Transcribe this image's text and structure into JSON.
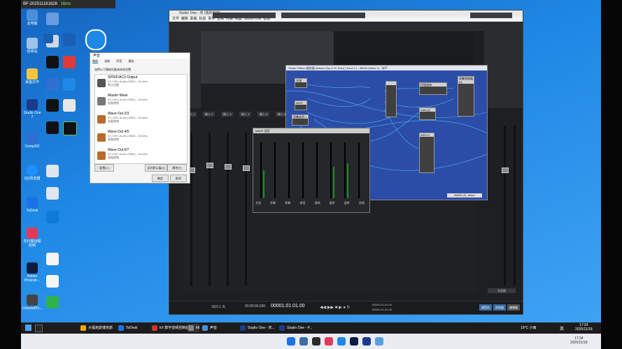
{
  "top_bar": {
    "id": "BF-202511181628",
    "latency": "16ms"
  },
  "desktop_icons": [
    {
      "label": "此电脑",
      "color": "#4a90d9"
    },
    {
      "label": "回收站",
      "color": "#a0c4e8"
    },
    {
      "label": "桌面文件",
      "color": "#f5c542"
    },
    {
      "label": "Studio One 7",
      "color": "#1b3b8a"
    },
    {
      "label": "Compil32",
      "color": "#2f6fd1"
    },
    {
      "label": "QQ浏览器",
      "color": "#1e90ff"
    },
    {
      "label": "ToDesk",
      "color": "#1a73e8"
    },
    {
      "label": "向日葵远程控制",
      "color": "#e03a5a"
    },
    {
      "label": "Adobe Photosh...",
      "color": "#0b1c3f"
    },
    {
      "label": "UninstallTo...",
      "color": "#444"
    }
  ],
  "studio_one": {
    "title": "Studio One - 宋 (我的歌曲)",
    "menu": [
      "文件",
      "编辑",
      "歌曲",
      "轨道",
      "事件",
      "音频",
      "传输",
      "视图",
      "Studio One",
      "帮助"
    ],
    "channel_labels": [
      "输入 1",
      "输入 2",
      "输入 3",
      "输入 4",
      "输入 5",
      "输入 6",
      "输入 7",
      "输入 8"
    ],
    "transport": {
      "time": "00001.01.01.00",
      "position": "16/3.1 大",
      "tempo": "00:00:00.000",
      "loop_start": "00001.01.01.00",
      "loop_end": "00001.01.01.00"
    },
    "right_buttons": [
      "调音台",
      "浏览器",
      "编辑器"
    ],
    "main_label": "主总线"
  },
  "routing_window": {
    "title": "Studio Edition 路由器 (Waves Sys 5 Ch Solo) [ Send 2 ] - 88005 (Wave 2) - 电平",
    "nodes": [
      {
        "label": "主线"
      },
      {
        "label": "ASIO"
      },
      {
        "label": "采集选项-1"
      },
      {
        "label": "环境混响"
      },
      {
        "label": "采集效果器 [1]"
      },
      {
        "label": "Gain [1]"
      },
      {
        "label": "ASIO-1"
      }
    ],
    "status": "88005 (5), Wave"
  },
  "mixer_window": {
    "title": "WAVE 混音",
    "channels": [
      "主动",
      "伴奏",
      "伴奏",
      "说话",
      "混响",
      "监听",
      "监听",
      "总线"
    ]
  },
  "sound_dialog": {
    "title": "声音",
    "tabs": [
      "播放",
      "录制",
      "声音",
      "通信"
    ],
    "instruction": "选择以下播放设备来修改设置:",
    "devices": [
      {
        "name": "SPDIF/AC3 Output",
        "driver": "KX 10K1 Audio (3552) - Generic",
        "status": "默认设备"
      },
      {
        "name": "Master Mixer",
        "driver": "KX 10K1 Audio (3552) - Generic",
        "status": "准备就绪"
      },
      {
        "name": "Wave Out 2/3",
        "driver": "KX 10K1 Audio (3552) - Generic",
        "status": "准备就绪"
      },
      {
        "name": "Wave Out 4/5",
        "driver": "KX 10K1 Audio (3552) - Generic",
        "status": "准备就绪"
      },
      {
        "name": "Wave Out 6/7",
        "driver": "KX 10K1 Audio (3552) - Generic",
        "status": "准备就绪"
      }
    ],
    "configure": "配置(C)",
    "set_default": "设为默认值(S)",
    "properties": "属性(P)",
    "ok": "确定",
    "cancel": "取消"
  },
  "taskbar": {
    "tasks": [
      {
        "label": "大福克斯博克斯",
        "color": "#f2a900"
      },
      {
        "label": "ToDesk",
        "color": "#1a73e8"
      },
      {
        "label": "kX 数字音频控制面板",
        "color": "#cc3333"
      },
      {
        "label": "Mi",
        "color": "#888"
      },
      {
        "label": "声音",
        "color": "#4a90d9"
      },
      {
        "label": "Studio One - 宋...",
        "color": "#1b3b8a"
      },
      {
        "label": "Studio One - P...",
        "color": "#1b3b8a"
      }
    ],
    "weather": "19°C 小雨",
    "lang": "英",
    "time": "17:24",
    "date": "2025/11/18"
  },
  "dock": {
    "time": "17:34",
    "date": "2025/11/18",
    "colors": [
      "#1a73e8",
      "#3a6ea5",
      "#2b2b2b",
      "#e03a5a",
      "#1e88e5",
      "#0b1c3f",
      "#1b3b8a",
      "#5aa0e0"
    ]
  }
}
